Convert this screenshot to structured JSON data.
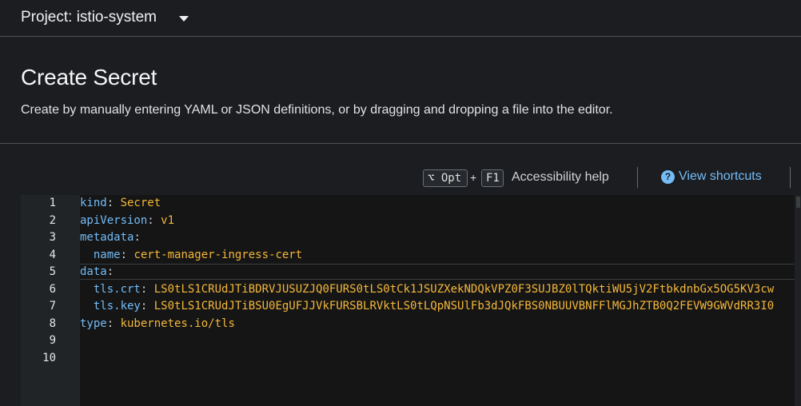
{
  "project": {
    "label": "Project: istio-system"
  },
  "page": {
    "title": "Create Secret",
    "description": "Create by manually entering YAML or JSON definitions, or by dragging and dropping a file into the editor."
  },
  "toolbar": {
    "key_opt": "⌥ Opt",
    "plus": "+",
    "key_f1": "F1",
    "accessibility_help": "Accessibility help",
    "help_icon": "?",
    "view_shortcuts": "View shortcuts"
  },
  "editor": {
    "line_numbers": [
      "1",
      "2",
      "3",
      "4",
      "5",
      "6",
      "7",
      "8",
      "9",
      "10"
    ],
    "lines": [
      {
        "indent": "",
        "key": "kind",
        "sep": ": ",
        "value": "Secret"
      },
      {
        "indent": "",
        "key": "apiVersion",
        "sep": ": ",
        "value": "v1"
      },
      {
        "indent": "",
        "key": "metadata",
        "sep": ":",
        "value": ""
      },
      {
        "indent": "  ",
        "key": "name",
        "sep": ": ",
        "value": "cert-manager-ingress-cert"
      },
      {
        "indent": "",
        "key": "data",
        "sep": ":",
        "value": ""
      },
      {
        "indent": "  ",
        "key": "tls.crt",
        "sep": ": ",
        "value": "LS0tLS1CRUdJTiBDRVJUSUZJQ0FURS0tLS0tCk1JSUZXekNDQkVPZ0F3SUJBZ0lTQktiWU5jV2FtbkdnbGx5OG5KV3cw"
      },
      {
        "indent": "  ",
        "key": "tls.key",
        "sep": ": ",
        "value": "LS0tLS1CRUdJTiBSU0EgUFJJVkFURSBLRVktLS0tLQpNSUlFb3dJQkFBS0NBUUVBNFFlMGJhZTB0Q2FEVW9GWVdRR3I0"
      },
      {
        "indent": "",
        "key": "type",
        "sep": ": ",
        "value": "kubernetes.io/tls"
      }
    ]
  },
  "colors": {
    "background": "#1b1d21",
    "editor_background": "#151515",
    "gutter_background": "#212427",
    "yaml_key": "#73bcf7",
    "yaml_value": "#f4b73a",
    "link": "#73bcf7"
  }
}
